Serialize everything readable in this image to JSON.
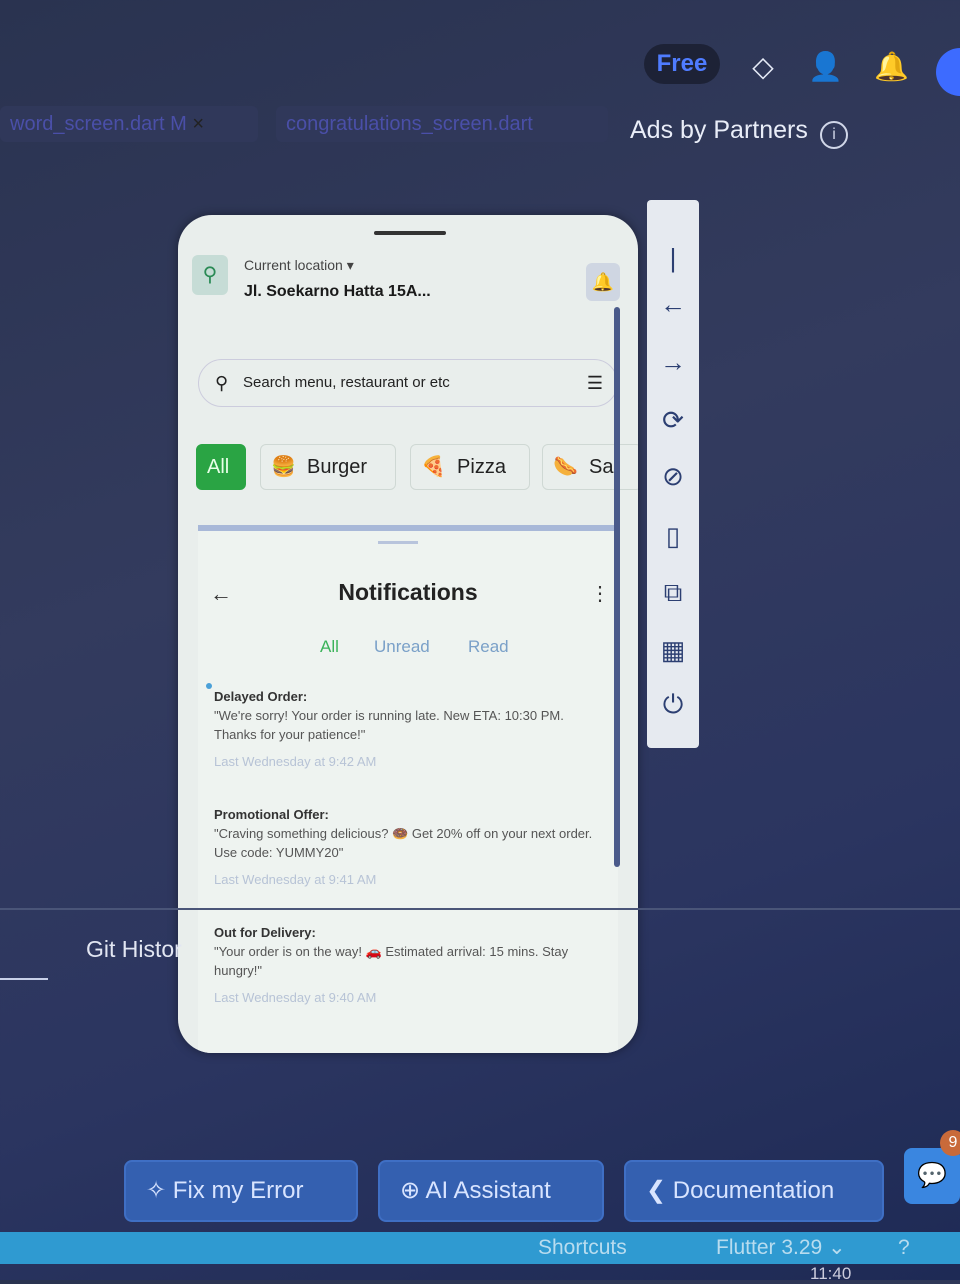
{
  "topbar": {
    "plan_label": "Free",
    "icons": [
      "layers-icon",
      "add-user-icon",
      "bell-icon"
    ]
  },
  "tabs": [
    {
      "label": "word_screen.dart M",
      "close": "×"
    },
    {
      "label": "congratulations_screen.dart"
    }
  ],
  "ads": {
    "label": "Ads by Partners",
    "info": "i"
  },
  "phone": {
    "location_label": "Current location ▾",
    "location_value": "Jl. Soekarno Hatta 15A...",
    "search_placeholder": "Search menu, restaurant or etc",
    "chips": [
      {
        "label": "All",
        "emoji": ""
      },
      {
        "label": "Burger",
        "emoji": "🍔"
      },
      {
        "label": "Pizza",
        "emoji": "🍕"
      },
      {
        "label": "Sar",
        "emoji": "🌭"
      }
    ],
    "notifications": {
      "title": "Notifications",
      "tabs": [
        "All",
        "Unread",
        "Read"
      ],
      "items": [
        {
          "title": "Delayed Order:",
          "body": "\"We're sorry! Your order is running late. New ETA: 10:30 PM. Thanks for your patience!\"",
          "time": "Last Wednesday at 9:42 AM",
          "unread": true
        },
        {
          "title": "Promotional Offer:",
          "body": "\"Craving something delicious? 🍩 Get 20% off on your next order. Use code: YUMMY20\"",
          "time": "Last Wednesday at 9:41 AM",
          "unread": false
        },
        {
          "title": "Out for Delivery:",
          "body": "\"Your order is on the way! 🚗 Estimated arrival: 15 mins. Stay hungry!\"",
          "time": "Last Wednesday at 9:40 AM",
          "unread": false
        }
      ]
    }
  },
  "panel": {
    "git_history": "Git Histor"
  },
  "bottom_buttons": [
    {
      "label": "Fix my Error"
    },
    {
      "label": "AI Assistant"
    },
    {
      "label": "Documentation"
    }
  ],
  "chat_badge": "9",
  "statusbar": {
    "shortcuts": "Shortcuts",
    "flutter_version": "Flutter 3.29 ⌄",
    "clock": "11:40"
  }
}
